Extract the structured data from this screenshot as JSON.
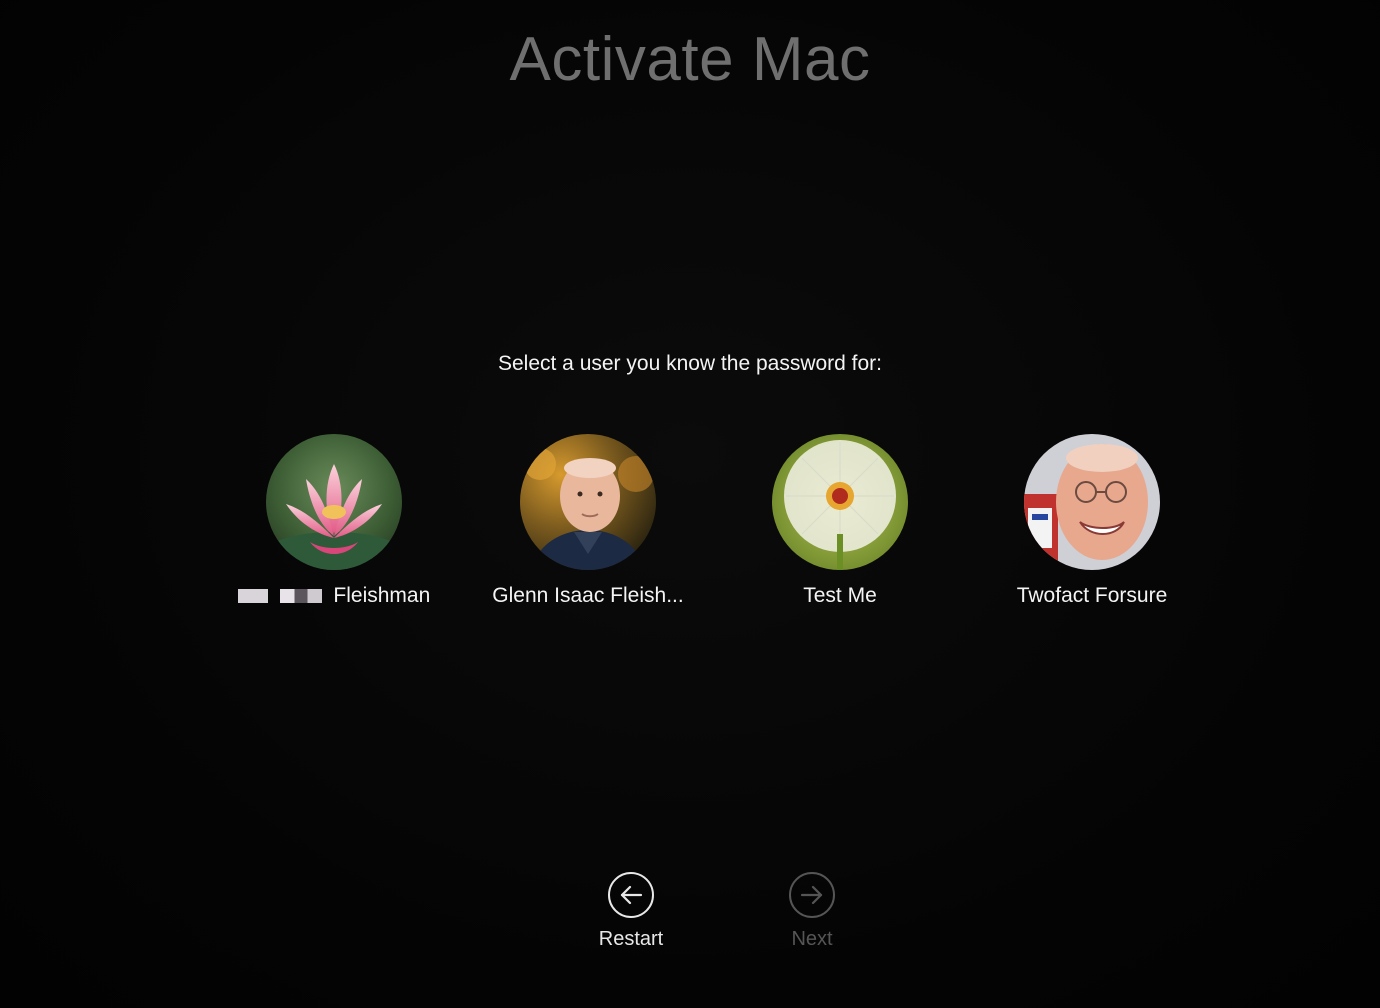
{
  "window": {
    "title": "Activate Mac"
  },
  "prompt": "Select a user you know the password for:",
  "users": [
    {
      "name": "Fleishman",
      "avatar": "pink-lotus-flower",
      "name_partially_redacted": true
    },
    {
      "name": "Glenn Isaac Fleish...",
      "avatar": "man-portrait-autumn"
    },
    {
      "name": "Test Me",
      "avatar": "dandelion"
    },
    {
      "name": "Twofact Forsure",
      "avatar": "smiling-man-glasses"
    }
  ],
  "navigation": {
    "restart_label": "Restart",
    "restart_icon": "arrow-left-circle-icon",
    "next_label": "Next",
    "next_icon": "arrow-right-circle-icon",
    "next_enabled": false
  },
  "colors": {
    "background": "#050505",
    "title": "#6f6f6f",
    "text": "#f4f4f4",
    "disabled": "#555555"
  }
}
